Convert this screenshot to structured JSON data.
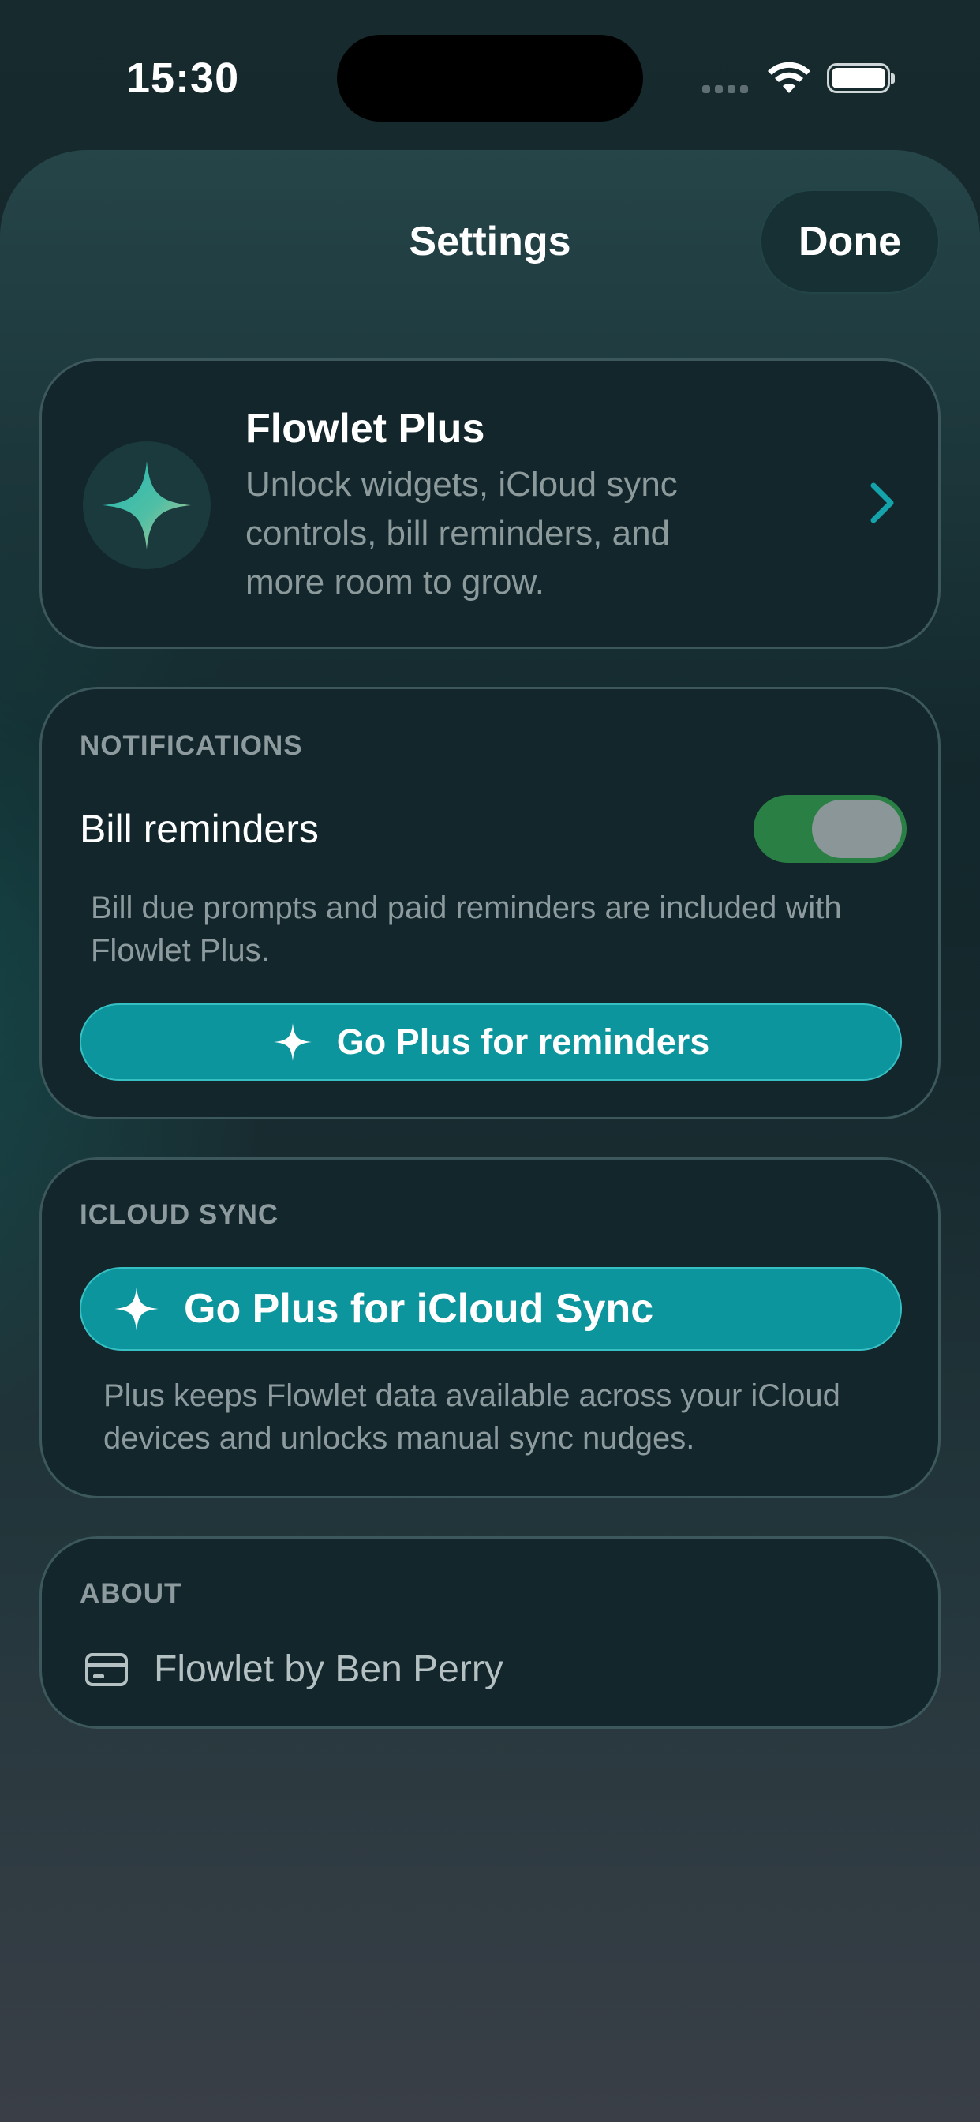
{
  "status_bar": {
    "time": "15:30"
  },
  "header": {
    "title": "Settings",
    "done_label": "Done"
  },
  "plus_card": {
    "title": "Flowlet Plus",
    "description": "Unlock widgets, iCloud sync controls, bill reminders, and more room to grow."
  },
  "notifications": {
    "header": "NOTIFICATIONS",
    "toggle_label": "Bill reminders",
    "toggle_on": true,
    "footnote": "Bill due prompts and paid reminders are included with Flowlet Plus.",
    "cta_label": "Go Plus for reminders"
  },
  "icloud": {
    "header": "ICLOUD SYNC",
    "cta_label": "Go Plus for iCloud Sync",
    "footnote": "Plus keeps Flowlet data available across your iCloud devices and unlocks manual sync nudges."
  },
  "about": {
    "header": "ABOUT",
    "icon": "creditcard-icon",
    "text": "Flowlet by Ben Perry"
  },
  "colors": {
    "accent": "#0C959C",
    "toggle_on": "#2A7F45",
    "card_bg": "#12262B"
  }
}
